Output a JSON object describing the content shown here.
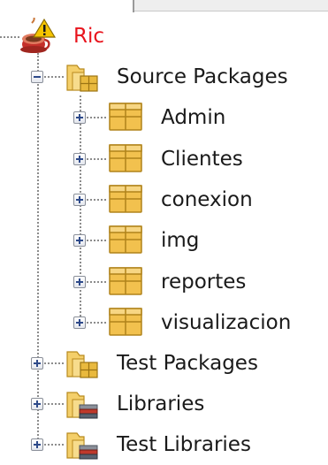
{
  "tree": {
    "project": {
      "label": "Ric",
      "icon": "java-project-icon",
      "expanded": true
    },
    "source_packages": {
      "label": "Source Packages",
      "icon": "source-packages-folder-icon",
      "expanded": true,
      "packages": [
        {
          "label": "Admin"
        },
        {
          "label": "Clientes"
        },
        {
          "label": "conexion"
        },
        {
          "label": "img"
        },
        {
          "label": "reportes"
        },
        {
          "label": "visualizacion"
        }
      ]
    },
    "test_packages": {
      "label": "Test Packages",
      "icon": "test-packages-folder-icon",
      "expanded": false
    },
    "libraries": {
      "label": "Libraries",
      "icon": "libraries-folder-icon",
      "expanded": false
    },
    "test_libraries": {
      "label": "Test Libraries",
      "icon": "test-libraries-folder-icon",
      "expanded": false
    }
  },
  "colors": {
    "project_label": "#e8141d",
    "package_icon": "#f2c14e",
    "folder_icon": "#f4cf6a",
    "guide_lines": "#8c8c8c"
  }
}
